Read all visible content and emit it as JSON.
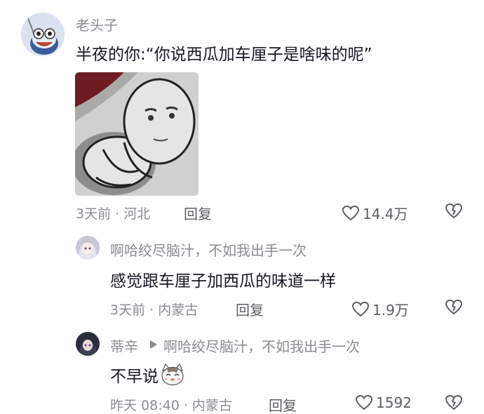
{
  "comments": [
    {
      "username": "老头子",
      "text": "半夜的你:“你说西瓜加车厘子是啥味的呢”",
      "meta": "3天前 · 河北",
      "reply_label": "回复",
      "likes": "14.4万",
      "sticker": "meme-sticker"
    },
    {
      "username": "啊哈绞尽脑汁，不如我出手一次",
      "text": "感觉跟车厘子加西瓜的味道一样",
      "meta": "3天前 · 内蒙古",
      "reply_label": "回复",
      "likes": "1.9万"
    },
    {
      "username": "蒂辛",
      "reply_to": "啊哈绞尽脑汁，不如我出手一次",
      "text": "不早说",
      "emoji": "cat-face-emoji",
      "meta": "昨天 08:40 · 内蒙古",
      "reply_label": "回复",
      "likes": "1592"
    }
  ],
  "icons": {
    "like": "heart-outline-icon",
    "dislike": "broken-heart-icon",
    "reply_arrow": "triangle-right-icon"
  }
}
